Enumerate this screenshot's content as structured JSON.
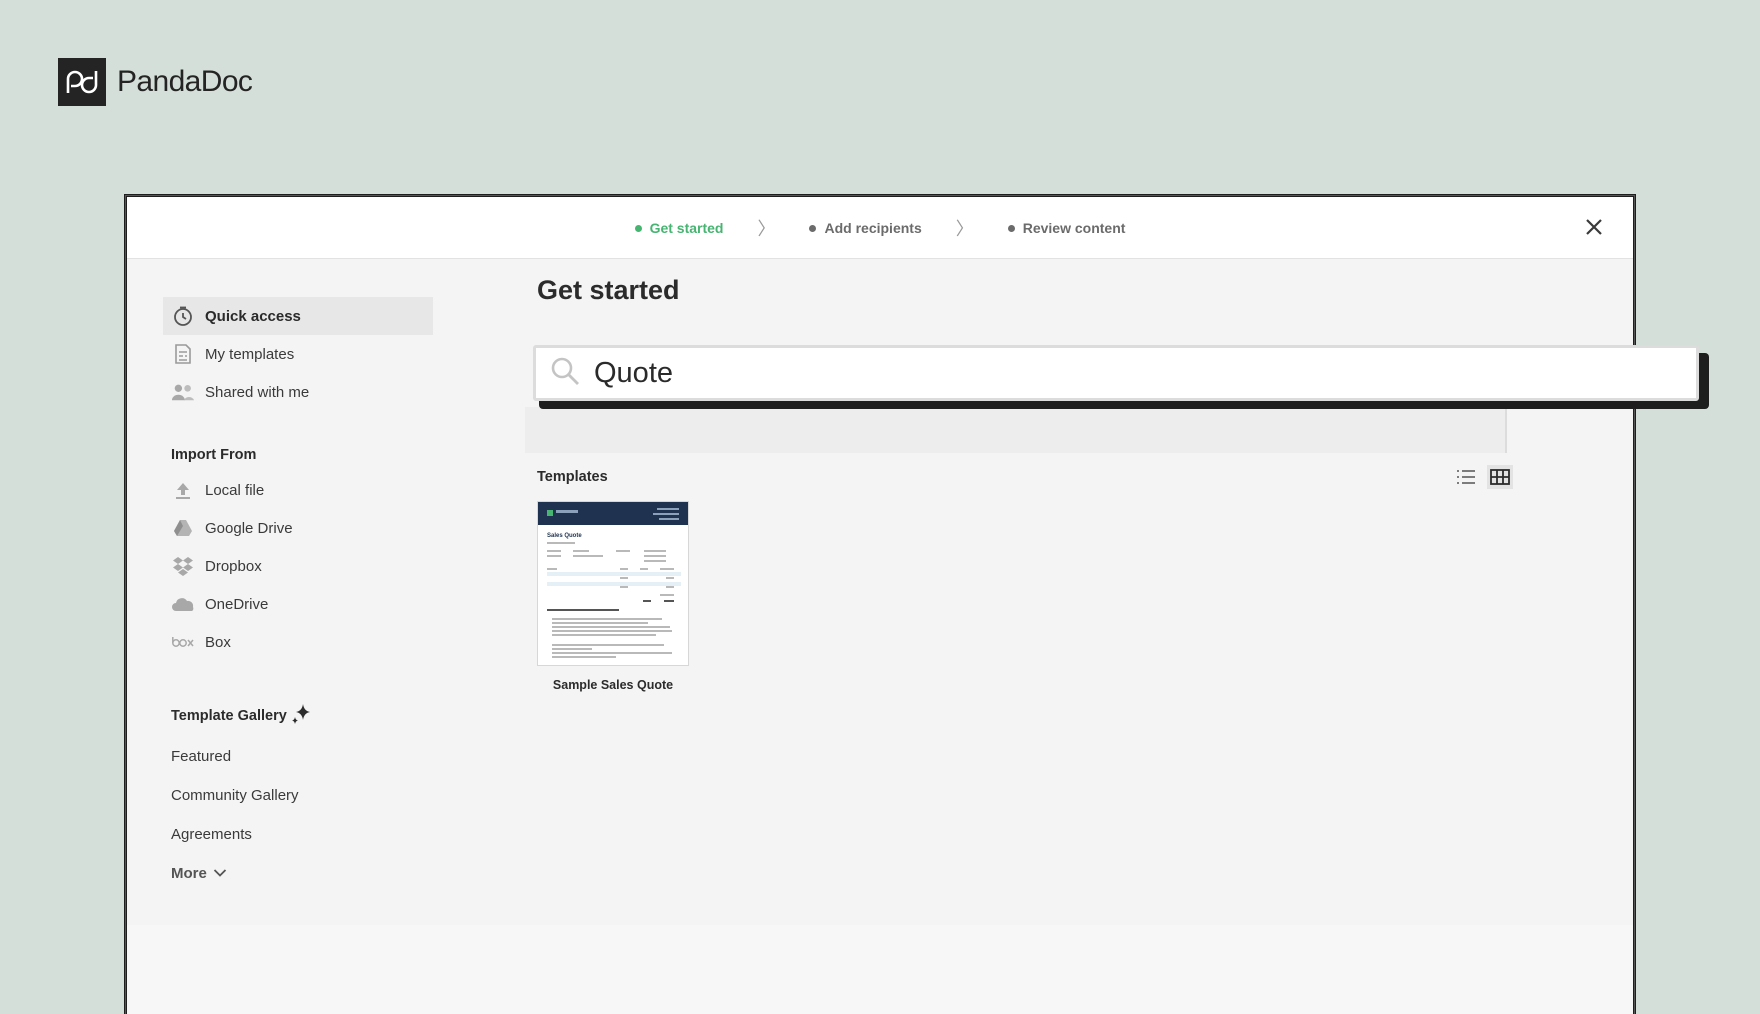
{
  "brand": {
    "name": "PandaDoc"
  },
  "wizard": {
    "steps": [
      {
        "label": "Get started",
        "active": true
      },
      {
        "label": "Add recipients",
        "active": false
      },
      {
        "label": "Review content",
        "active": false
      }
    ]
  },
  "sidebar": {
    "nav": [
      {
        "label": "Quick access",
        "icon": "clock-icon",
        "active": true
      },
      {
        "label": "My templates",
        "icon": "template-icon"
      },
      {
        "label": "Shared with me",
        "icon": "users-icon"
      }
    ],
    "import_title": "Import From",
    "imports": [
      {
        "label": "Local file",
        "icon": "upload-icon"
      },
      {
        "label": "Google Drive",
        "icon": "google-drive-icon"
      },
      {
        "label": "Dropbox",
        "icon": "dropbox-icon"
      },
      {
        "label": "OneDrive",
        "icon": "onedrive-icon"
      },
      {
        "label": "Box",
        "icon": "box-icon"
      }
    ],
    "gallery_title": "Template Gallery",
    "gallery": [
      {
        "label": "Featured"
      },
      {
        "label": "Community Gallery"
      },
      {
        "label": "Agreements"
      }
    ],
    "more_label": "More"
  },
  "main": {
    "title": "Get started",
    "search": {
      "value": "Quote"
    },
    "templates_label": "Templates",
    "view_mode": "grid",
    "cards": [
      {
        "name": "Sample Sales Quote",
        "thumb_title": "Sales Quote"
      }
    ]
  },
  "colors": {
    "accent": "#47b471",
    "background": "#d5dfd9",
    "thumb_header": "#1f3350"
  }
}
